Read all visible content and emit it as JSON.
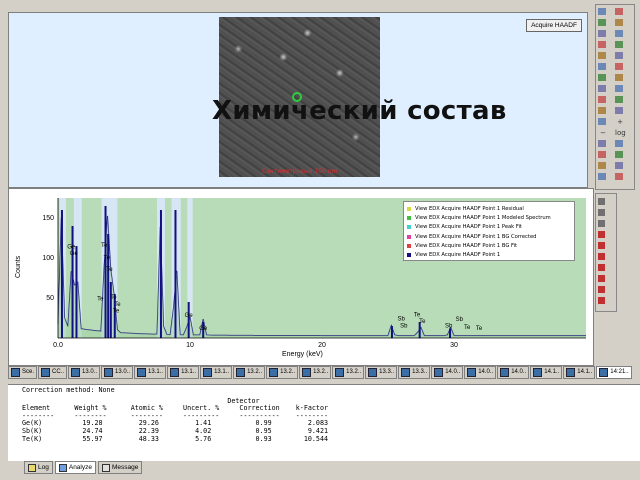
{
  "image_panel": {
    "acquire_button": "Acquire HAADF",
    "scale_label": "Сантиметровый 100 nm"
  },
  "overlay_title": "Химический состав",
  "chart_data": {
    "type": "line",
    "xlabel": "Energy (keV)",
    "ylabel": "Counts",
    "xlim": [
      0,
      40
    ],
    "ylim": [
      0,
      175
    ],
    "x_ticks": [
      "0.0",
      "10",
      "20",
      "30"
    ],
    "y_ticks": [
      "50",
      "100",
      "150"
    ],
    "grid": false,
    "background": "#b8dcb8",
    "legend_position": "top-right",
    "legend": [
      {
        "name": "View EDX Acquire HAADF Point 1 Residual",
        "color": "#d8d840"
      },
      {
        "name": "View EDX Acquire HAADF Point 1 Modeled Spectrum",
        "color": "#40c040"
      },
      {
        "name": "View EDX Acquire HAADF Point 1 Peak Fit",
        "color": "#40d0d0"
      },
      {
        "name": "View EDX Acquire HAADF Point 1 BG Corrected",
        "color": "#e040a0"
      },
      {
        "name": "View EDX Acquire HAADF Point 1 BG Fit",
        "color": "#e04040"
      },
      {
        "name": "View EDX Acquire HAADF Point 1",
        "color": "#101080"
      }
    ],
    "peaks": [
      {
        "x": 0.3,
        "y": 160
      },
      {
        "x": 1.1,
        "y": 140
      },
      {
        "x": 1.4,
        "y": 115
      },
      {
        "x": 3.6,
        "y": 165
      },
      {
        "x": 3.8,
        "y": 130
      },
      {
        "x": 4.0,
        "y": 70
      },
      {
        "x": 4.3,
        "y": 55
      },
      {
        "x": 7.8,
        "y": 160
      },
      {
        "x": 8.9,
        "y": 160
      },
      {
        "x": 9.9,
        "y": 45
      },
      {
        "x": 11.0,
        "y": 20
      },
      {
        "x": 25.3,
        "y": 15
      },
      {
        "x": 27.4,
        "y": 20
      },
      {
        "x": 29.7,
        "y": 12
      }
    ],
    "peak_labels": [
      {
        "text": "Ge",
        "x": 1.0,
        "y": 112
      },
      {
        "text": "Ge",
        "x": 1.2,
        "y": 104
      },
      {
        "text": "Te",
        "x": 3.5,
        "y": 114
      },
      {
        "text": "Te",
        "x": 3.7,
        "y": 98
      },
      {
        "text": "Te",
        "x": 3.9,
        "y": 84
      },
      {
        "text": "Te",
        "x": 3.2,
        "y": 47
      },
      {
        "text": "Te",
        "x": 4.2,
        "y": 49
      },
      {
        "text": "Te",
        "x": 4.5,
        "y": 40
      },
      {
        "text": "Te",
        "x": 4.4,
        "y": 32
      },
      {
        "text": "Ge",
        "x": 9.9,
        "y": 26
      },
      {
        "text": "Ge",
        "x": 11.0,
        "y": 10
      },
      {
        "text": "Sb",
        "x": 26.0,
        "y": 22
      },
      {
        "text": "Sb",
        "x": 26.2,
        "y": 13
      },
      {
        "text": "Te",
        "x": 27.2,
        "y": 27
      },
      {
        "text": "Te",
        "x": 27.6,
        "y": 19
      },
      {
        "text": "Sb",
        "x": 29.6,
        "y": 13
      },
      {
        "text": "Sb",
        "x": 30.4,
        "y": 21
      },
      {
        "text": "Te",
        "x": 31.0,
        "y": 11
      },
      {
        "text": "Te",
        "x": 31.9,
        "y": 10
      }
    ]
  },
  "tabs": [
    {
      "label": "Sce.",
      "active": false
    },
    {
      "label": "CC..",
      "active": false
    },
    {
      "label": "13.0..",
      "active": false
    },
    {
      "label": "13.0..",
      "active": false
    },
    {
      "label": "13.1..",
      "active": false
    },
    {
      "label": "13.1..",
      "active": false
    },
    {
      "label": "13.1..",
      "active": false
    },
    {
      "label": "13.2..",
      "active": false
    },
    {
      "label": "13.2..",
      "active": false
    },
    {
      "label": "13.2..",
      "active": false
    },
    {
      "label": "13.2..",
      "active": false
    },
    {
      "label": "13.3..",
      "active": false
    },
    {
      "label": "13.3..",
      "active": false
    },
    {
      "label": "14.0..",
      "active": false
    },
    {
      "label": "14.0..",
      "active": false
    },
    {
      "label": "14.0..",
      "active": false
    },
    {
      "label": "14.1..",
      "active": false
    },
    {
      "label": "14.1..",
      "active": false
    },
    {
      "label": "14:21..",
      "active": true
    }
  ],
  "results": {
    "method_line": "Correction method: None",
    "header1": "                                                   Detector",
    "header2": "Element      Weight %      Atomic %     Uncert. %     Correction    k-Factor",
    "divider": "--------     --------      --------     ---------     ----------    --------",
    "rows": [
      "Ge(K)          19.28         29.26         1.41           0.99         2.083",
      "Sb(K)          24.74         22.39         4.02           0.95         9.421",
      "Te(K)          55.97         48.33         5.76           0.93        10.544"
    ]
  },
  "bottom_tabs": [
    {
      "label": "Log",
      "active": false
    },
    {
      "label": "Analyze",
      "active": true
    },
    {
      "label": "Message",
      "active": false
    }
  ],
  "toolbar1": [
    "select-icon",
    "eye-icon",
    "fit-icon",
    "copy-icon",
    "zoom-icon",
    "hand-icon",
    "rotate-icon",
    "line-icon",
    "rect-icon",
    "circle-icon",
    "text-icon",
    "measure-icon",
    "grid-icon",
    "contrast-icon",
    "histogram-icon",
    "print-icon",
    "save-icon",
    "filter-icon",
    "frame-icon",
    "profile-icon",
    "image-icon",
    "plus-icon",
    "minus-icon",
    "log-icon",
    "fft-icon",
    "mask-icon",
    "layer-icon",
    "color-icon",
    "settings-icon",
    "export-icon",
    "info-icon",
    "chart-icon"
  ],
  "toolbar2": [
    "pointer-icon",
    "lasso-icon",
    "magnify-icon",
    "target-icon",
    "crosshair-icon",
    "marker-icon",
    "line-icon",
    "rect-icon",
    "ellipse-icon",
    "text-icon"
  ]
}
